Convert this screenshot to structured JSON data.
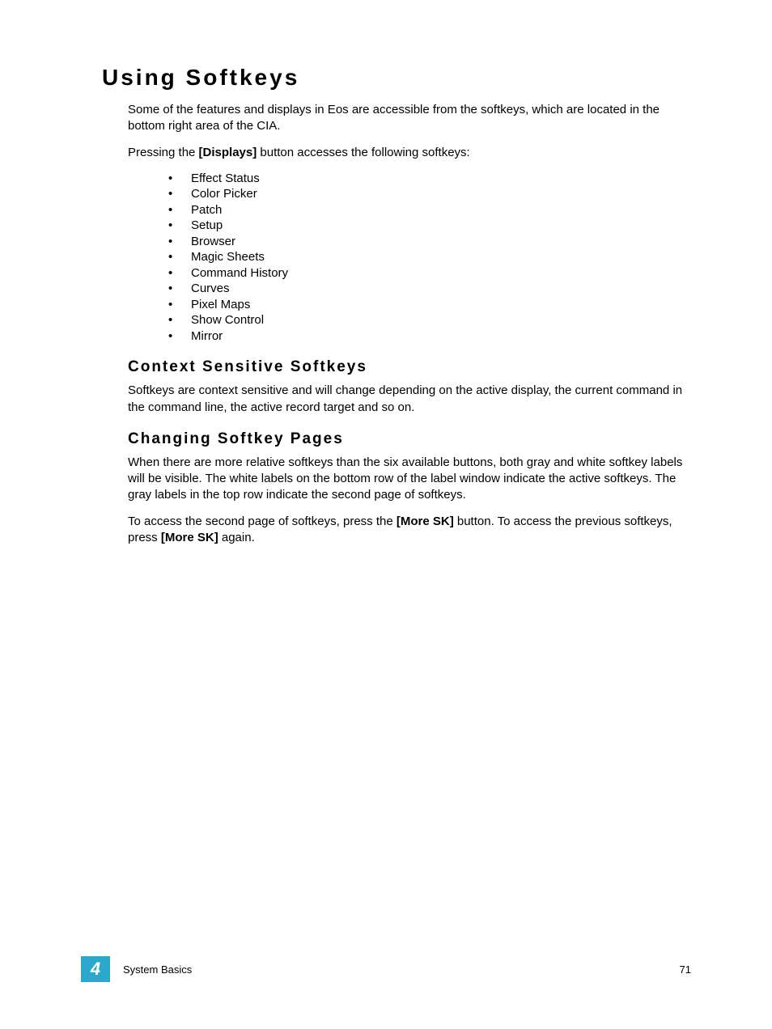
{
  "headings": {
    "main": "Using Softkeys",
    "context": "Context Sensitive Softkeys",
    "changing": "Changing Softkey Pages"
  },
  "paragraphs": {
    "intro": "Some of the features and displays in Eos are accessible from the softkeys, which are located in the bottom right area of the CIA.",
    "pressing_pre": "Pressing the ",
    "pressing_bold": "[Displays]",
    "pressing_post": " button accesses the following softkeys:",
    "context_body": "Softkeys are context sensitive and will change depending on the active display, the current command in the command line, the active record target and so on.",
    "changing_body1": "When there are more relative softkeys than the six available buttons, both gray and white softkey labels will be visible. The white labels on the bottom row of the label window indicate the active softkeys. The gray labels in the top row indicate the second page of softkeys.",
    "changing_body2_pre": "To access the second page of softkeys, press the ",
    "changing_body2_bold1": "[More SK]",
    "changing_body2_mid": " button. To access the previous softkeys, press ",
    "changing_body2_bold2": "[More SK]",
    "changing_body2_post": " again."
  },
  "bullets": [
    "Effect Status",
    "Color Picker",
    "Patch",
    "Setup",
    "Browser",
    "Magic Sheets",
    "Command History",
    "Curves",
    "Pixel Maps",
    "Show Control",
    "Mirror"
  ],
  "footer": {
    "chapter": "4",
    "section": "System Basics",
    "page": "71"
  }
}
